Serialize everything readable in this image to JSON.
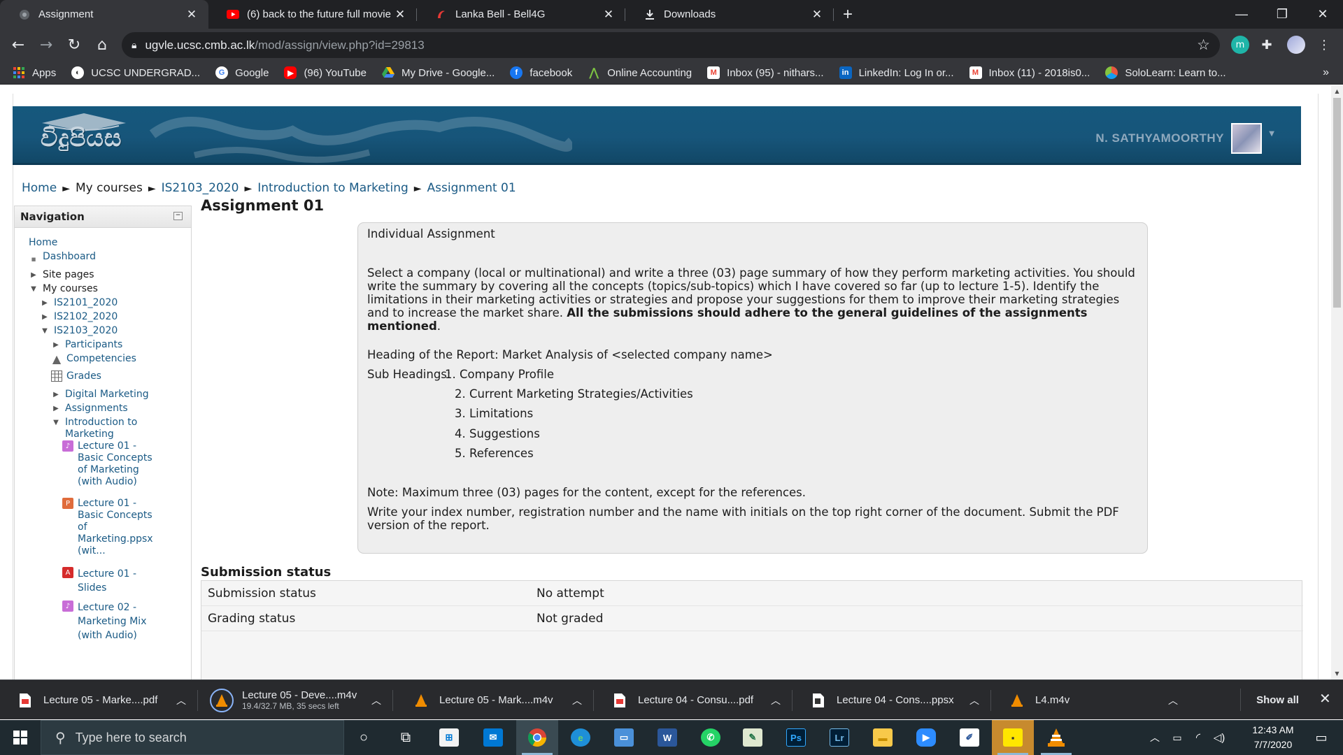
{
  "browser": {
    "tabs": [
      {
        "title": "Assignment",
        "icon": "moodle-icon",
        "active": true
      },
      {
        "title": "(6) back to the future full movie -",
        "icon": "youtube-icon",
        "active": false
      },
      {
        "title": "Lanka Bell - Bell4G",
        "icon": "lankabell-icon",
        "active": false
      },
      {
        "title": "Downloads",
        "icon": "download-icon",
        "active": false
      }
    ],
    "new_tab": "+",
    "url_host": "ugvle.ucsc.cmb.ac.lk",
    "url_path": "/mod/assign/view.php?id=29813",
    "bookmarks": [
      {
        "label": "Apps",
        "icon": "apps-grid-icon",
        "color": "#ea4335"
      },
      {
        "label": "UCSC UNDERGRAD...",
        "icon": "globe-icon",
        "color": "#ffffff"
      },
      {
        "label": "Google",
        "icon": "google-icon",
        "color": "#ffffff"
      },
      {
        "label": "(96) YouTube",
        "icon": "youtube-icon",
        "color": "#ff0000"
      },
      {
        "label": "My Drive - Google...",
        "icon": "drive-icon",
        "color": "#fbbc04"
      },
      {
        "label": "facebook",
        "icon": "facebook-icon",
        "color": "#1877f2"
      },
      {
        "label": "Online Accounting",
        "icon": "accounting-icon",
        "color": "#7cc242"
      },
      {
        "label": "Inbox (95) - nithars...",
        "icon": "gmail-icon",
        "color": "#ea4335"
      },
      {
        "label": "LinkedIn: Log In or...",
        "icon": "linkedin-icon",
        "color": "#0a66c2"
      },
      {
        "label": "Inbox (11) - 2018is0...",
        "icon": "gmail-icon",
        "color": "#ea4335"
      },
      {
        "label": "SoloLearn: Learn to...",
        "icon": "sololearn-icon",
        "color": "#e8573f"
      }
    ],
    "bookmarks_more": "»"
  },
  "site": {
    "logo_text": "විදුපියස",
    "user_name": "N. SATHYAMOORTHY"
  },
  "breadcrumb": [
    {
      "label": "Home",
      "link": true
    },
    {
      "label": "My courses",
      "link": false
    },
    {
      "label": "IS2103_2020",
      "link": true
    },
    {
      "label": "Introduction to Marketing",
      "link": true
    },
    {
      "label": "Assignment 01",
      "link": true
    }
  ],
  "breadcrumb_sep": "►",
  "navigation": {
    "title": "Navigation",
    "collapse": "−",
    "items": [
      {
        "label": "Home",
        "link": true
      },
      {
        "label": "Dashboard",
        "link": true
      },
      {
        "label": "Site pages",
        "link": false
      },
      {
        "label": "My courses",
        "link": false
      },
      {
        "label": "IS2101_2020",
        "link": true
      },
      {
        "label": "IS2102_2020",
        "link": true
      },
      {
        "label": "IS2103_2020",
        "link": true
      },
      {
        "label": "Participants",
        "link": true
      },
      {
        "label": "Competencies",
        "link": true
      },
      {
        "label": "Grades",
        "link": true
      },
      {
        "label": "Digital Marketing",
        "link": true
      },
      {
        "label": "Assignments",
        "link": true
      },
      {
        "label": "Introduction to Marketing",
        "link": true
      },
      {
        "label": "Lecture 01 - Basic Concepts of Marketing (with Audio)",
        "link": true
      },
      {
        "label": "Lecture 01 - Basic Concepts of Marketing.ppsx (wit...",
        "link": true
      },
      {
        "label": "Lecture 01 - Slides",
        "link": true
      },
      {
        "label": "Lecture 02 - Marketing Mix (with Audio)",
        "link": true
      }
    ]
  },
  "assignment": {
    "title": "Assignment 01",
    "intro_heading": "Individual Assignment",
    "intro_paragraph": "Select a company (local or multinational) and write a three (03) page summary of how they perform marketing activities. You should write the summary by covering all the concepts (topics/sub-topics) which I have covered so far (up to lecture 1-5). Identify the limitations in their marketing activities or strategies and propose your suggestions for them to improve their marketing strategies and to increase the market share.",
    "intro_bold": "All the submissions should adhere to the general guidelines of the assignments mentioned",
    "intro_end": ".",
    "report_heading": "Heading of the Report: Market Analysis of <selected company name>",
    "subheadings_label": "Sub Headings:",
    "subheadings": [
      "1. Company Profile",
      "2. Current Marketing Strategies/Activities",
      "3. Limitations",
      "4. Suggestions",
      "5. References"
    ],
    "note": "Note: Maximum three (03) pages for the content, except for the references.",
    "instructions": "Write your index number, registration number and the name with initials on the top right corner of the document. Submit the PDF version of the report."
  },
  "submission": {
    "title": "Submission status",
    "rows": [
      {
        "key": "Submission status",
        "value": "No attempt"
      },
      {
        "key": "Grading status",
        "value": "Not graded"
      }
    ]
  },
  "downloads": {
    "items": [
      {
        "name": "Lecture 05 - Marke....pdf",
        "sub": "",
        "icon": "pdf-icon"
      },
      {
        "name": "Lecture 05 - Deve....m4v",
        "sub": "19.4/32.7 MB, 35 secs left",
        "icon": "vlc-icon"
      },
      {
        "name": "Lecture 05 - Mark....m4v",
        "sub": "",
        "icon": "vlc-icon"
      },
      {
        "name": "Lecture 04 - Consu....pdf",
        "sub": "",
        "icon": "pdf-icon"
      },
      {
        "name": "Lecture 04 - Cons....ppsx",
        "sub": "",
        "icon": "powerpoint-icon"
      },
      {
        "name": "L4.m4v",
        "sub": "",
        "icon": "vlc-icon"
      }
    ],
    "show_all": "Show all"
  },
  "taskbar": {
    "search_placeholder": "Type here to search",
    "time": "12:43 AM",
    "date": "7/7/2020"
  },
  "colors": {
    "banner": "#15587d",
    "link": "#1a5a85",
    "chrome_dark": "#202124"
  }
}
